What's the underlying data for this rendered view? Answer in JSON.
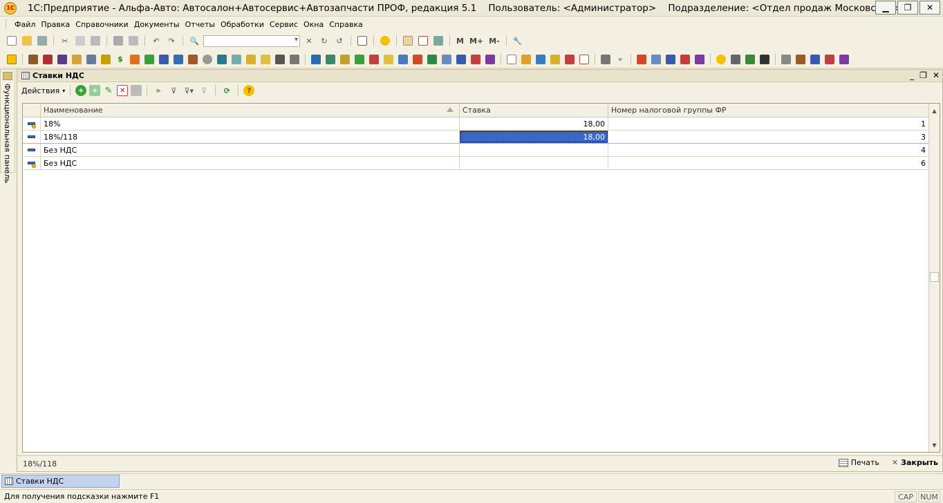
{
  "window": {
    "title": "1С:Предприятие - Альфа-Авто: Автосалон+Автосервис+Автозапчасти ПРОФ, редакция 5.1    Пользователь: <Администратор>    Подразделение: <Отдел продаж Московский>",
    "app_icon_label": "1С"
  },
  "menu": {
    "items": [
      "Файл",
      "Правка",
      "Справочники",
      "Документы",
      "Отчеты",
      "Обработки",
      "Сервис",
      "Окна",
      "Справка"
    ]
  },
  "toolbar": {
    "m_label": "M",
    "mplus_label": "M+",
    "mminus_label": "M-"
  },
  "functional_panel": {
    "label": "Функциональная панель"
  },
  "document": {
    "title": "Ставки НДС",
    "actions_label": "Действия",
    "columns": [
      "Наименование",
      "Ставка",
      "Номер налоговой группы ФР"
    ],
    "rows": [
      {
        "name": "18%",
        "rate": "18,00",
        "group": "1"
      },
      {
        "name": "18%/118",
        "rate": "18,00",
        "group": "3"
      },
      {
        "name": "Без НДС",
        "rate": "",
        "group": "4"
      },
      {
        "name": "Без НДС",
        "rate": "",
        "group": "6"
      }
    ],
    "current_item": "18%/118",
    "print_label": "Печать",
    "close_label": "Закрыть"
  },
  "taskbar": {
    "tab_label": "Ставки НДС"
  },
  "status": {
    "hint": "Для получения подсказки нажмите F1",
    "cap": "CAP",
    "num": "NUM"
  },
  "colors": {
    "selection": "#3a67c4",
    "taskbar_tab": "#c1d3ee",
    "background": "#f4f1e3"
  }
}
